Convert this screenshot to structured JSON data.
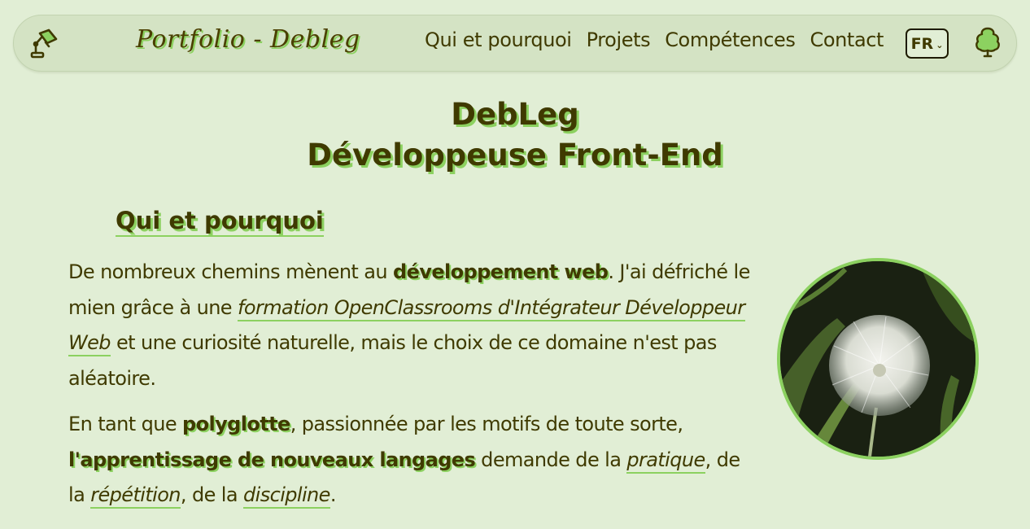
{
  "nav": {
    "brand": "Portfolio - Debleg",
    "links": [
      "Qui et pourquoi",
      "Projets",
      "Compétences",
      "Contact"
    ],
    "language": "FR",
    "lamp_icon": "desk-lamp-icon",
    "tree_icon": "tree-icon"
  },
  "hero": {
    "line1": "DebLeg",
    "line2": "Développeuse Front-End"
  },
  "section": {
    "title": "Qui et pourquoi",
    "p1": {
      "t1": "De nombreux chemins mènent au ",
      "b1": "développement web",
      "t2": ". J'ai défriché le mien grâce à une ",
      "i1": "formation OpenClassrooms d'Intégrateur Développeur Web",
      "t3": " et une curiosité naturelle, mais le choix de ce domaine n'est pas aléatoire."
    },
    "p2": {
      "t1": "En tant que ",
      "b1": "polyglotte",
      "t2": ", passionnée par les motifs de toute sorte, ",
      "b2": "l'apprentissage de nouveaux langages",
      "t3": " demande de la ",
      "i1": "pratique",
      "t4": ", de la ",
      "i2": "répétition",
      "t5": ", de la ",
      "i3": "discipline",
      "t6": "."
    }
  },
  "colors": {
    "background": "#e1eed5",
    "navbar": "#d4e3c4",
    "text": "#3f3a00",
    "accent": "#8cd160"
  }
}
